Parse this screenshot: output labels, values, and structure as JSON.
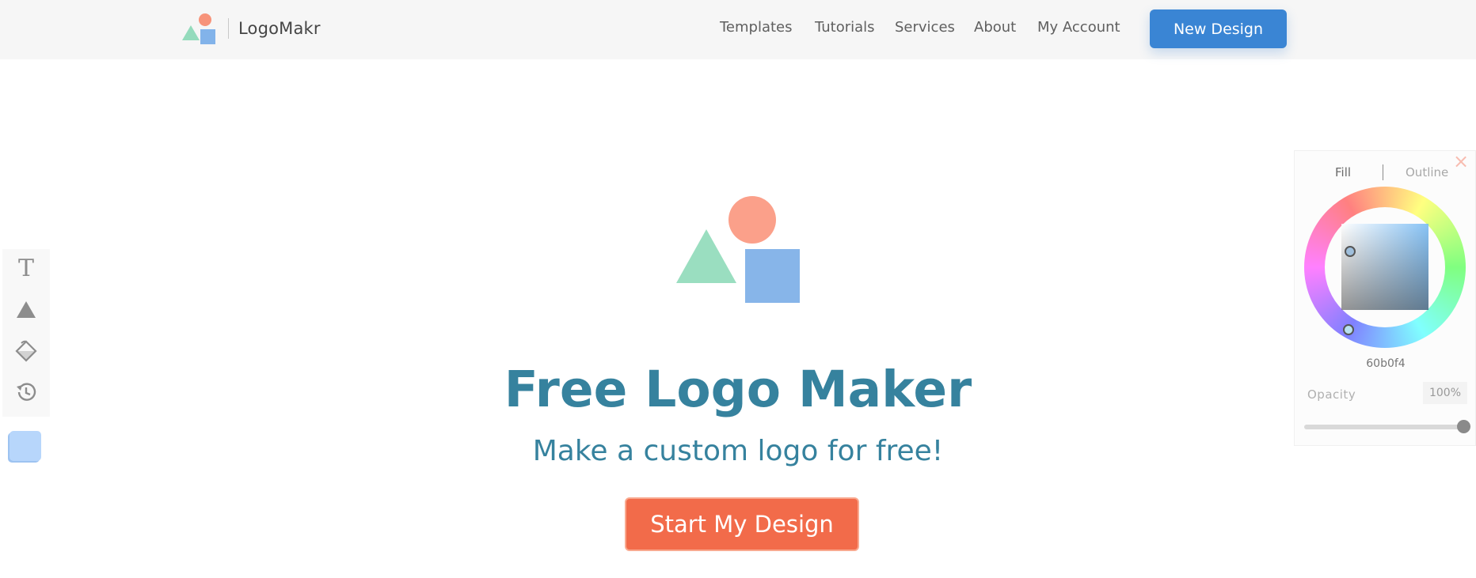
{
  "header": {
    "brand_name": "LogoMakr",
    "nav": [
      {
        "label": "Templates"
      },
      {
        "label": "Tutorials"
      },
      {
        "label": "Services"
      },
      {
        "label": "About"
      },
      {
        "label": "My Account"
      }
    ],
    "cta_label": "New Design"
  },
  "hero": {
    "title": "Free Logo Maker",
    "subtitle": "Make a custom logo for free!",
    "cta_label": "Start My Design"
  },
  "toolbar": {
    "tools": [
      {
        "name": "text-tool",
        "glyph": "T"
      },
      {
        "name": "shape-tool",
        "icon": "triangle-icon"
      },
      {
        "name": "fill-tool",
        "icon": "paint-bucket-icon"
      },
      {
        "name": "history-tool",
        "icon": "history-icon"
      }
    ],
    "swatch_color": "#b7d6fb"
  },
  "color_panel": {
    "close_glyph": "×",
    "tab_fill": "Fill",
    "tab_outline": "Outline",
    "hex_value": "60b0f4",
    "opacity_label": "Opacity",
    "opacity_value": "100%",
    "opacity_fraction": 1.0
  },
  "colors": {
    "brand_coral": "#f7937a",
    "brand_green": "#94dbbc",
    "brand_blue": "#82b3ea",
    "primary_button": "#3a85d4",
    "title_teal": "#36829e",
    "start_button": "#f26b4a",
    "selected_color": "#60b0f4"
  }
}
